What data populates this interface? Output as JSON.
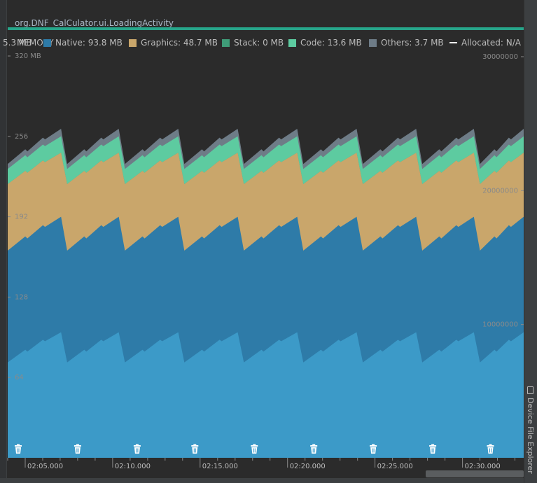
{
  "activity_title": "org.DNF_CalCulator.ui.LoadingActivity",
  "legend": {
    "total_label": "5.3 MB",
    "section_label": "MEMORY",
    "items": [
      {
        "key": "native",
        "label": "Native: 93.8 MB",
        "color": "#2e7ba8"
      },
      {
        "key": "graphics",
        "label": "Graphics: 48.7 MB",
        "color": "#c9a66b"
      },
      {
        "key": "stack",
        "label": "Stack: 0 MB",
        "color": "#3f9c78"
      },
      {
        "key": "code",
        "label": "Code: 13.6 MB",
        "color": "#5dcba0"
      },
      {
        "key": "others",
        "label": "Others: 3.7 MB",
        "color": "#6e7c87"
      },
      {
        "key": "allocated",
        "label": "Allocated: N/A",
        "color": "#ffffff"
      }
    ]
  },
  "icons": {
    "gc_event": "trash-can-icon",
    "device_file_explorer": "device-icon"
  },
  "sidebar": {
    "device_file_explorer_label": "Device File Explorer"
  },
  "chart_data": {
    "type": "area",
    "stacked": true,
    "x_unit": "time",
    "x_range": [
      "02:04.000",
      "02:33.500"
    ],
    "x_ticks": [
      "02:05.000",
      "02:10.000",
      "02:15.000",
      "02:20.000",
      "02:25.000",
      "02:30.000"
    ],
    "left_axis": {
      "unit": "MB",
      "ticks": [
        "320 MB",
        "256",
        "192",
        "128",
        "64"
      ],
      "ylim": [
        0,
        320
      ]
    },
    "right_axis": {
      "ticks": [
        "30000000",
        "20000000",
        "10000000"
      ],
      "ylim": [
        0,
        30000000
      ]
    },
    "grid": false,
    "legend_position": "top",
    "series_order": [
      "Java",
      "Native",
      "Graphics",
      "Stack",
      "Code",
      "Others"
    ],
    "colors": {
      "Java": "#3c9ac8",
      "Native": "#2e7ba8",
      "Graphics": "#c9a66b",
      "Stack": "#3f9c78",
      "Code": "#5dcba0",
      "Others": "#6e7c87"
    },
    "cycle_start_times": [
      "02:04.000",
      "02:07.400",
      "02:10.700",
      "02:14.100",
      "02:17.500",
      "02:20.900",
      "02:24.300",
      "02:27.700",
      "02:31.000"
    ],
    "cycle_period_s": 3.4,
    "cumulative_top_mb": {
      "Java": {
        "low": 76,
        "high": 100
      },
      "Native": {
        "low": 165,
        "high": 192
      },
      "Graphics": {
        "low": 218,
        "high": 243
      },
      "Stack": {
        "low": 218,
        "high": 243
      },
      "Code": {
        "low": 230,
        "high": 256
      },
      "Others": {
        "low": 234,
        "high": 262
      }
    },
    "gc_event_times": [
      "02:04.600",
      "02:08.000",
      "02:11.400",
      "02:14.700",
      "02:18.100",
      "02:21.500",
      "02:24.900",
      "02:28.300",
      "02:31.600"
    ]
  }
}
